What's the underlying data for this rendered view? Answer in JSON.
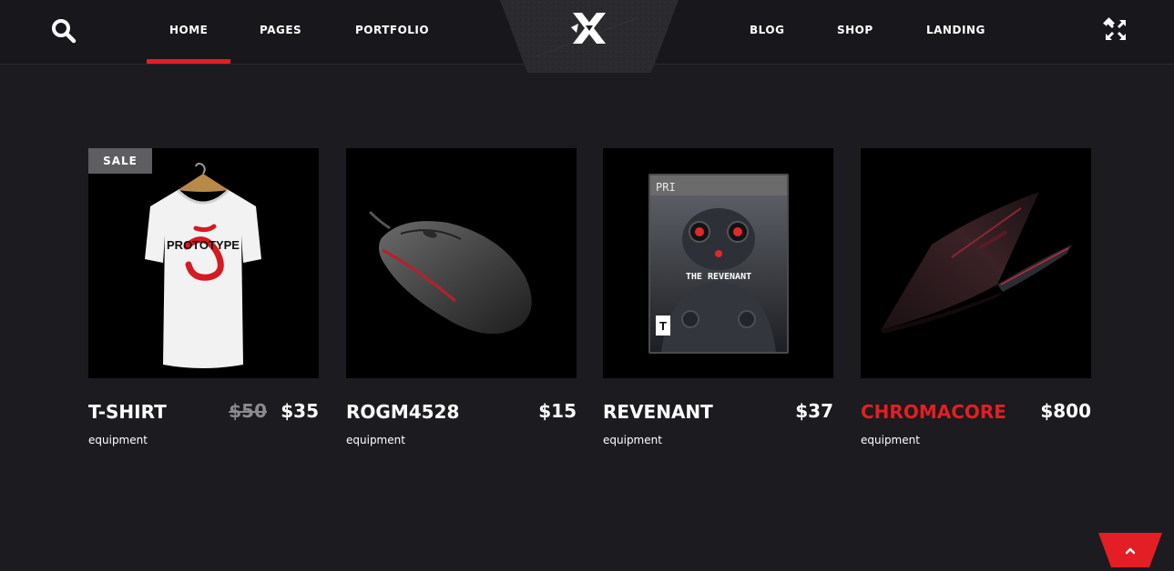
{
  "nav": {
    "search_icon": "search-icon",
    "items": [
      {
        "label": "HOME",
        "active": true
      },
      {
        "label": "PAGES",
        "active": false
      },
      {
        "label": "PORTFOLIO",
        "active": false
      },
      {
        "label": "BLOG",
        "active": false
      },
      {
        "label": "SHOP",
        "active": false
      },
      {
        "label": "LANDING",
        "active": false
      }
    ],
    "logo_icon": "x-logo-icon",
    "fullscreen_icon": "fullscreen-icon"
  },
  "products": [
    {
      "name": "T-SHIRT",
      "old_price": "$50",
      "price": "$35",
      "category": "equipment",
      "badge": "SALE",
      "image": "tshirt-image",
      "shirt_print": "PROTOTYPE"
    },
    {
      "name": "ROGM4528",
      "price": "$15",
      "category": "equipment",
      "image": "mouse-image"
    },
    {
      "name": "REVENANT",
      "price": "$37",
      "category": "equipment",
      "image": "game-cover-image",
      "cover_brand": "PRI",
      "cover_title": "THE REVENANT",
      "cover_rating": "T"
    },
    {
      "name": "CHROMACORE",
      "price": "$800",
      "category": "equipment",
      "image": "laptop-image",
      "highlight": true
    }
  ],
  "colors": {
    "accent": "#e31e24",
    "background": "#1c1b1f",
    "header": "#18171b",
    "badge": "#5e5d61"
  },
  "back_to_top_icon": "chevron-up-icon"
}
